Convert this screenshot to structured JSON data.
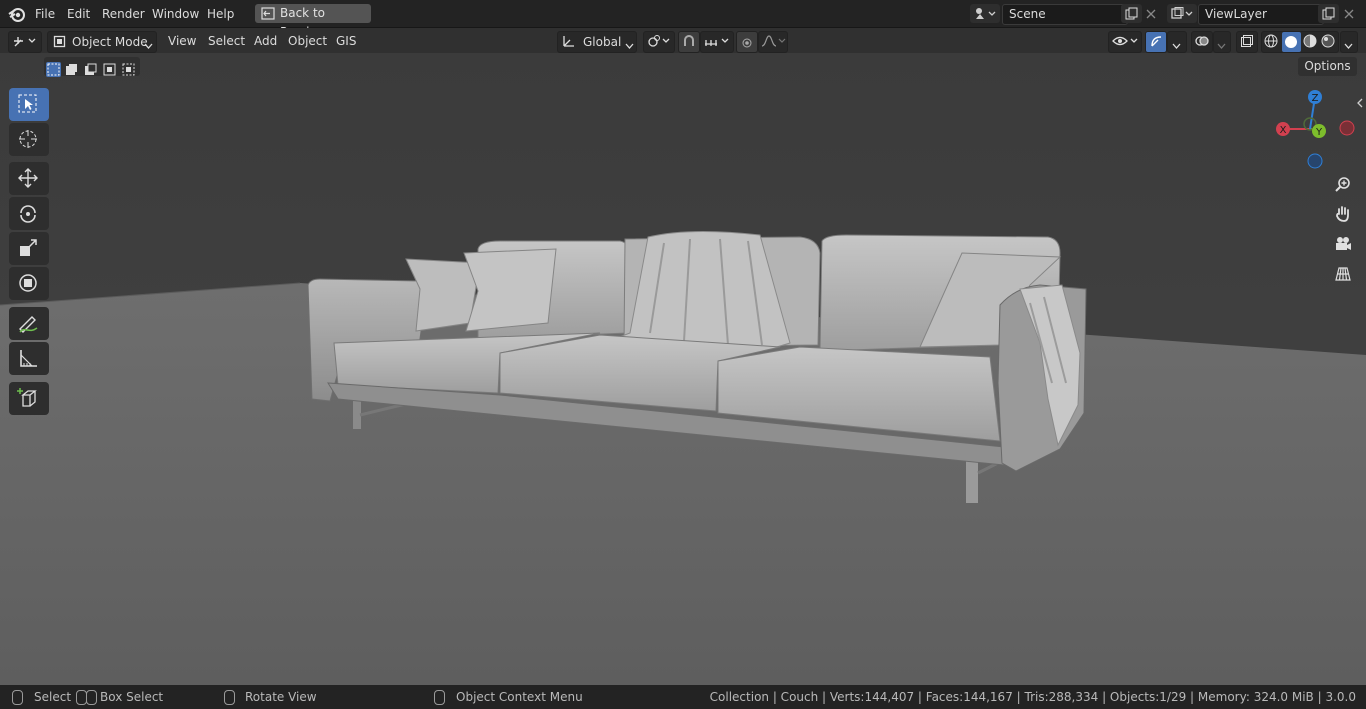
{
  "menu": {
    "items": [
      "File",
      "Edit",
      "Render",
      "Window",
      "Help"
    ],
    "back_button": "Back to Previous"
  },
  "top_right": {
    "scene": "Scene",
    "view_layer": "ViewLayer"
  },
  "header": {
    "mode": "Object Mode",
    "menus": [
      "View",
      "Select",
      "Add",
      "Object",
      "GIS"
    ],
    "orientation": "Global",
    "options_label": "Options"
  },
  "gizmo": {
    "x": "X",
    "y": "Y",
    "z": "Z"
  },
  "status": {
    "select": "Select",
    "box_select": "Box Select",
    "rotate_view": "Rotate View",
    "context_menu": "Object Context Menu",
    "stats": "Collection | Couch | Verts:144,407 | Faces:144,167 | Tris:288,334 | Objects:1/29 | Memory: 324.0 MiB | 3.0.0"
  },
  "colors": {
    "accent": "#4772b3",
    "axis_x": "#d2404f",
    "axis_y": "#7dbd2c",
    "axis_z": "#2f7fd6"
  }
}
